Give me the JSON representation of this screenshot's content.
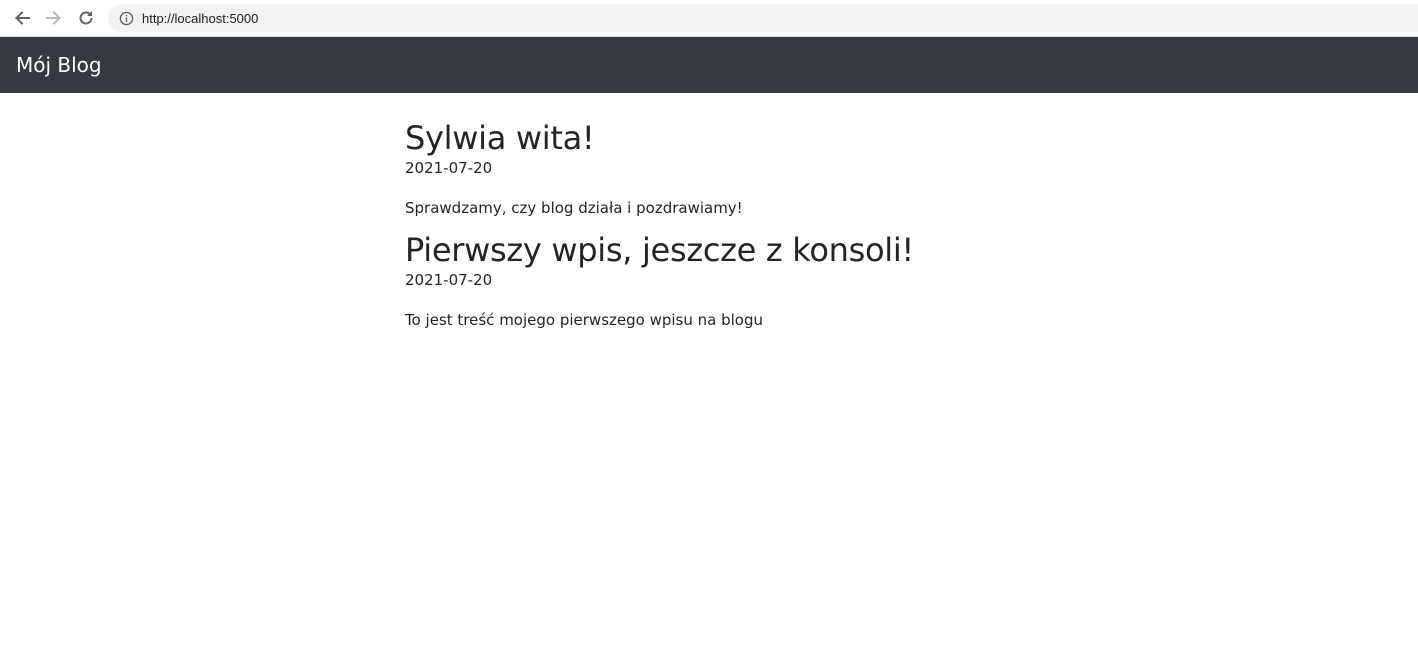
{
  "browser": {
    "url": "http://localhost:5000",
    "icons": {
      "back": "arrow-left-icon",
      "forward": "arrow-right-icon",
      "reload": "reload-icon",
      "site_info": "info-icon"
    }
  },
  "navbar": {
    "brand": "Mój Blog",
    "background": "#343a40"
  },
  "posts": [
    {
      "title": "Sylwia wita!",
      "date": "2021-07-20",
      "body": "Sprawdzamy, czy blog działa i pozdrawiamy!"
    },
    {
      "title": "Pierwszy wpis, jeszcze z konsoli!",
      "date": "2021-07-20",
      "body": "To jest treść mojego pierwszego wpisu na blogu"
    }
  ]
}
